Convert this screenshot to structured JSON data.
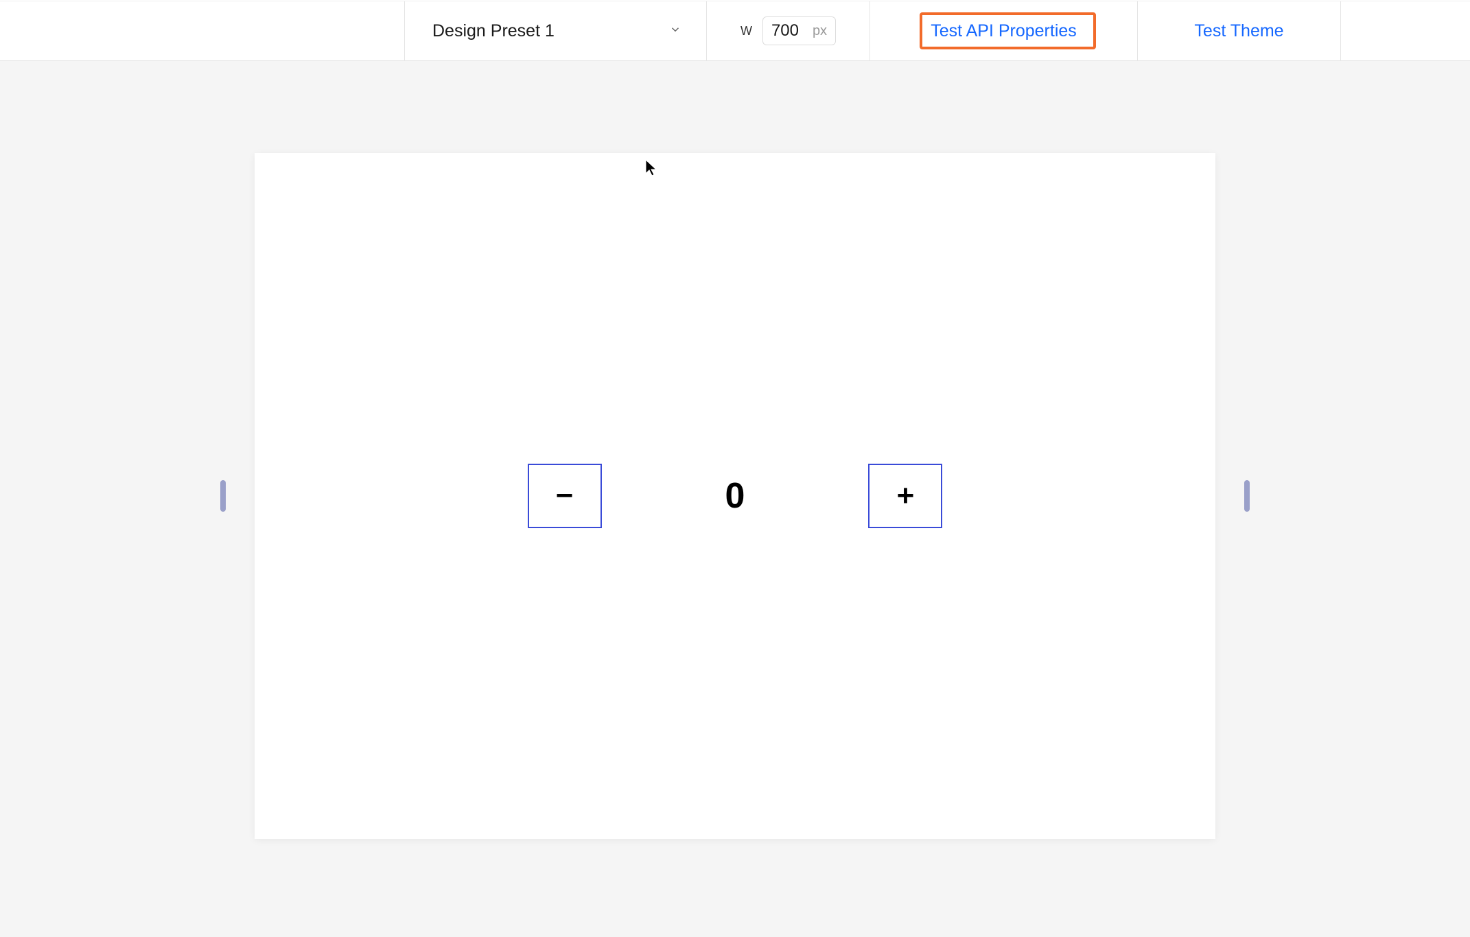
{
  "toolbar": {
    "preset_label": "Design Preset 1",
    "width_label": "W",
    "width_value": "700",
    "width_unit": "px",
    "test_api_label": "Test API Properties",
    "test_theme_label": "Test Theme"
  },
  "counter": {
    "decrement": "−",
    "value": "0",
    "increment": "+"
  }
}
